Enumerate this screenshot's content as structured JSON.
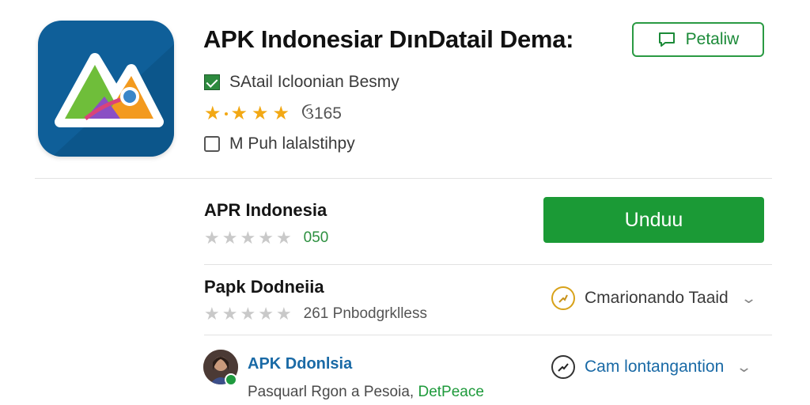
{
  "app": {
    "title": "APK Indonesiar DınDatail Dema:",
    "header_button_label": "Petaliw",
    "developer": "SAtail Icloonian Besmy",
    "rating_value": "ઉ165",
    "rating_stars": 4,
    "extra_info": "M Puh lalalstihpy",
    "icon_name": "app-logo-icon"
  },
  "items": [
    {
      "title": "APR Indonesia",
      "stars_filled": 0,
      "count": "050",
      "button_label": "Unduu"
    },
    {
      "title": "Papk Dodneiia",
      "stars_filled": 0,
      "subtitle": "261 Pnbodgrklless",
      "action_label": "Cmarionando Taaid"
    },
    {
      "title": "APK Ddonlsia",
      "subtitle_prefix": "Pasquarl Rgon a Pesoia,",
      "subtitle_link": "DetPeace",
      "action_label": "Cam lontangantion"
    }
  ],
  "colors": {
    "primary_green": "#1b9a36",
    "outline_green": "#2a9a43",
    "star_gold": "#f2a814",
    "link_blue": "#1a6aa6",
    "icon_bg": "#0f5f99"
  },
  "icons": [
    "app-logo-icon",
    "message-icon",
    "verified-check-icon",
    "checkbox-icon",
    "star-icon",
    "clock-icon",
    "trend-icon",
    "chevron-down-icon",
    "avatar"
  ]
}
